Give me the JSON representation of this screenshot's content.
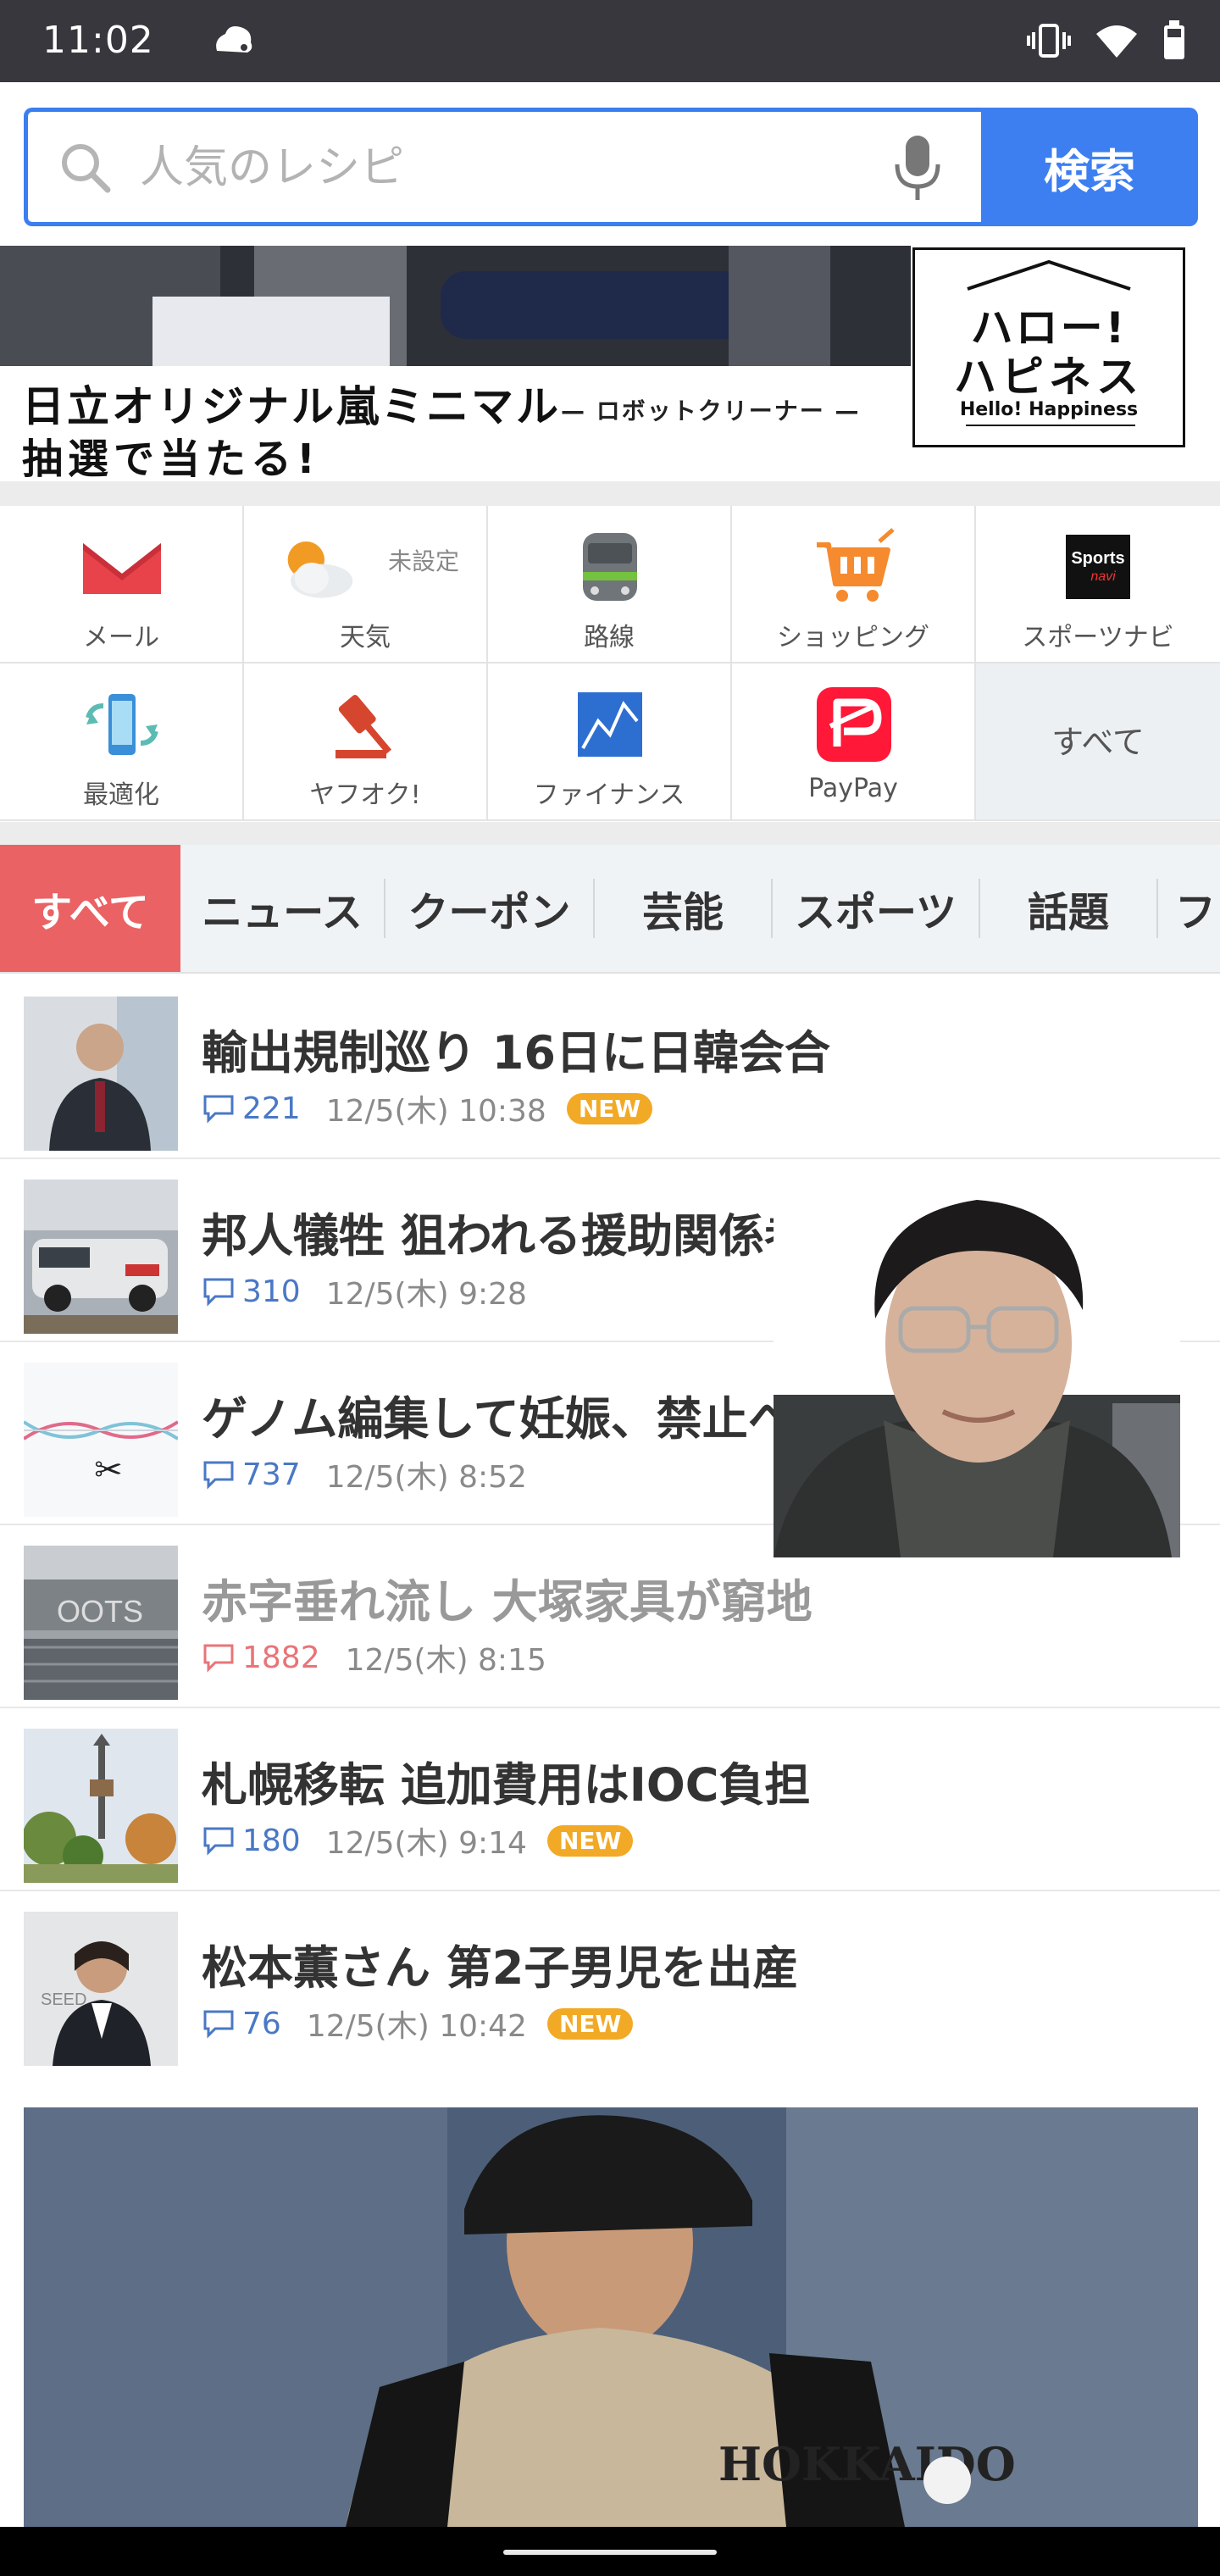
{
  "status_bar": {
    "time": "11:02",
    "icons": [
      "notification-cloud-icon",
      "vibrate-icon",
      "wifi-icon",
      "battery-icon"
    ]
  },
  "search": {
    "placeholder": "人気のレシピ",
    "button_label": "検索"
  },
  "banner": {
    "line1": "日立オリジナル嵐ミニマル",
    "line1_sub": "— ロボットクリーナー —",
    "line2": "抽選で当たる!",
    "logo_line1": "ハロー!",
    "logo_line2": "ハピネス",
    "logo_line3": "Hello! Happiness"
  },
  "apps": [
    {
      "label": "メール",
      "icon": "mail-icon"
    },
    {
      "label": "天気",
      "icon": "weather-icon",
      "sub": "未設定"
    },
    {
      "label": "路線",
      "icon": "train-icon"
    },
    {
      "label": "ショッピング",
      "icon": "shopping-cart-icon"
    },
    {
      "label": "スポーツナビ",
      "icon": "sportsnavi-icon",
      "icon_text": "Sports navi"
    },
    {
      "label": "最適化",
      "icon": "phone-optimize-icon"
    },
    {
      "label": "ヤフオク!",
      "icon": "auction-gavel-icon"
    },
    {
      "label": "ファイナンス",
      "icon": "finance-chart-icon"
    },
    {
      "label": "PayPay",
      "icon": "paypay-icon"
    },
    {
      "label": "すべて"
    }
  ],
  "tabs": [
    {
      "label": "すべて",
      "active": true
    },
    {
      "label": "ニュース"
    },
    {
      "label": "クーポン"
    },
    {
      "label": "芸能"
    },
    {
      "label": "スポーツ"
    },
    {
      "label": "話題"
    },
    {
      "label": "フ"
    }
  ],
  "news": [
    {
      "title": "輸出規制巡り 16日に日韓会合",
      "comments": "221",
      "date": "12/5(木) 10:38",
      "badge": "NEW"
    },
    {
      "title": "邦人犠牲 狙われる援助関係者",
      "comments": "310",
      "date": "12/5(木) 9:28"
    },
    {
      "title": "ゲノム編集して妊娠、禁止へ",
      "comments": "737",
      "date": "12/5(木) 8:52"
    },
    {
      "title": "赤字垂れ流し 大塚家具が窮地",
      "comments": "1882",
      "date": "12/5(木) 8:15",
      "read": true
    },
    {
      "title": "札幌移転 追加費用はIOC負担",
      "comments": "180",
      "date": "12/5(木) 9:14",
      "badge": "NEW"
    },
    {
      "title": "松本薫さん 第2子男児を出産",
      "comments": "76",
      "date": "12/5(木) 10:42",
      "badge": "NEW"
    }
  ],
  "colors": {
    "accent_blue": "#3d7ff1",
    "active_tab": "#ea6264",
    "new_badge": "#f2a925",
    "status_bar": "#37373d"
  }
}
